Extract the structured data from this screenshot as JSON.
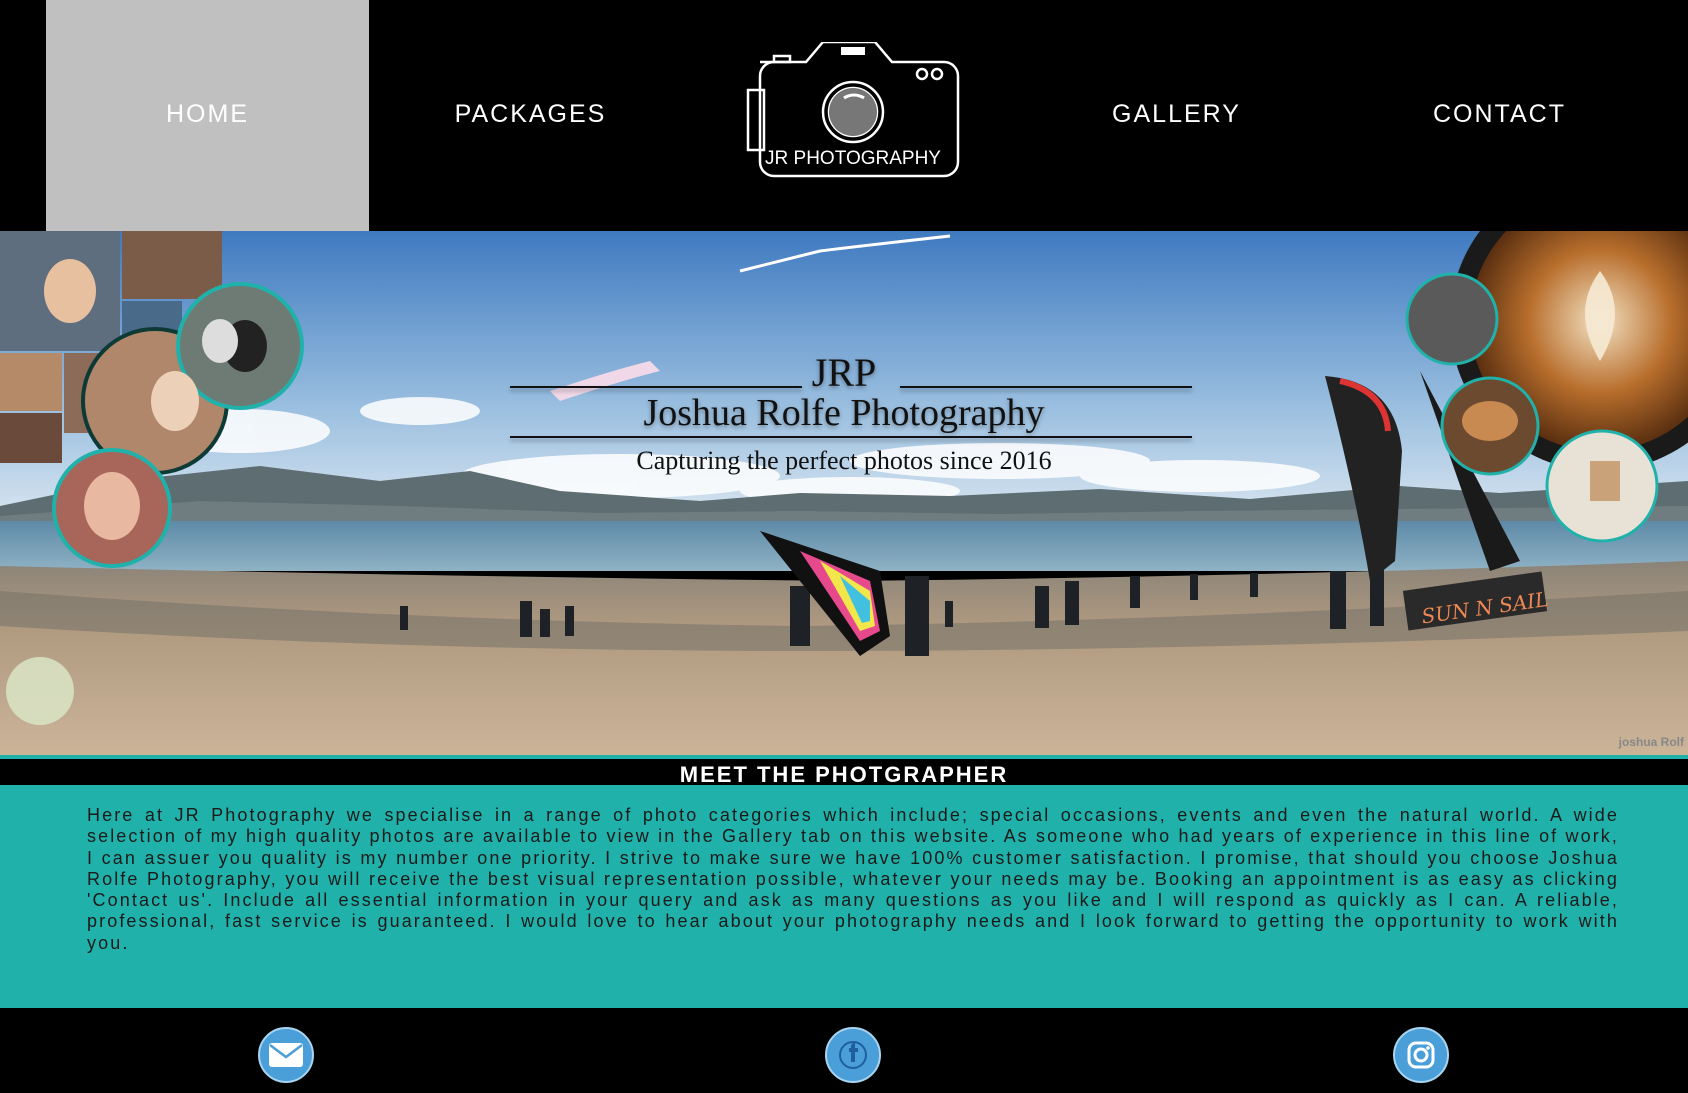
{
  "nav": {
    "items": [
      {
        "label": "HOME",
        "active": true
      },
      {
        "label": "PACKAGES",
        "active": false
      },
      {
        "label": "GALLERY",
        "active": false
      },
      {
        "label": "CONTACT",
        "active": false
      }
    ],
    "logo_text": "JR PHOTOGRAPHY",
    "active_color": "#c0c0c0"
  },
  "hero": {
    "title_short": "JRP",
    "title_full": "Joshua Rolfe Photography",
    "tagline": "Capturing the perfect photos since 2016",
    "banner_text": "SUN N SAIL",
    "watermark": "joshua Rolf"
  },
  "meet": {
    "heading": "MEET THE PHOTGRAPHER",
    "body": "Here at JR Photography we specialise in a range of photo categories which include; special occasions, events and even the natural world. A wide selection of my high quality photos are available to view in the Gallery tab on this website. As someone who had years of experience in this line of work, I can assuer you quality is my number one priority. I strive to make sure we have 100% customer satisfaction. I promise, that should you choose Joshua Rolfe Photography, you will receive the best visual representation possible, whatever your needs may be. Booking an appointment is as easy as clicking 'Contact us'. Include all essential information in your query and ask as many questions as you like and I will respond as quickly as I can. A reliable, professional, fast service is guaranteed. I would love to hear about your photography needs and I look forward to getting the opportunity to work with you.",
    "accent_color": "#20b2aa"
  },
  "footer": {
    "icons": [
      "mail-icon",
      "facebook-icon",
      "instagram-icon"
    ],
    "icon_color": "#4a9fd8"
  }
}
